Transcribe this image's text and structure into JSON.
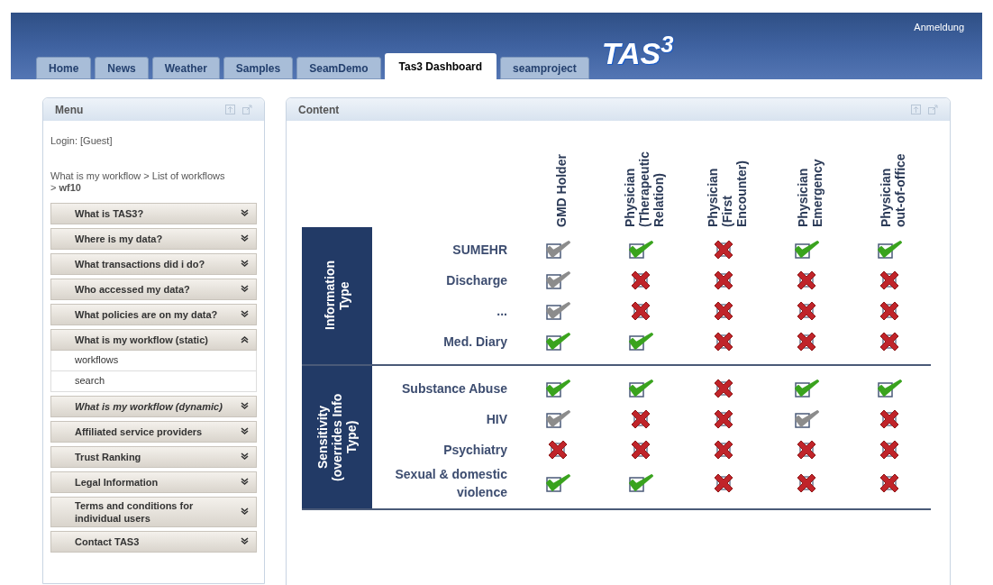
{
  "header": {
    "logo": "TAS$^{3}$",
    "login_link": "Anmeldung"
  },
  "tabs": [
    {
      "label": "Home",
      "selected": false
    },
    {
      "label": "News",
      "selected": false
    },
    {
      "label": "Weather",
      "selected": false
    },
    {
      "label": "Samples",
      "selected": false
    },
    {
      "label": "SeamDemo",
      "selected": false
    },
    {
      "label": "Tas3 Dashboard",
      "selected": true
    },
    {
      "label": "seamproject",
      "selected": false
    }
  ],
  "menu": {
    "title": "Menu",
    "login": "Login: [Guest]",
    "breadcrumb": "What is my workflow > List of workflows > **wf10**",
    "items": [
      {
        "label": "What is TAS3?",
        "expanded": false,
        "emphasized": false
      },
      {
        "label": "Where is my data?",
        "expanded": false,
        "emphasized": false
      },
      {
        "label": "What transactions did i do?",
        "expanded": false,
        "emphasized": false
      },
      {
        "label": "Who accessed my data?",
        "expanded": false,
        "emphasized": false
      },
      {
        "label": "What policies are on my data?",
        "expanded": false,
        "emphasized": false
      },
      {
        "label": "What is my workflow (static)",
        "expanded": true,
        "emphasized": false,
        "children": [
          "workflows",
          "search"
        ]
      },
      {
        "label": "What is my workflow (dynamic)",
        "expanded": false,
        "emphasized": true
      },
      {
        "label": "Affiliated service providers",
        "expanded": false,
        "emphasized": false
      },
      {
        "label": "Trust Ranking",
        "expanded": false,
        "emphasized": false
      },
      {
        "label": "Legal Information",
        "expanded": false,
        "emphasized": false
      },
      {
        "label": "Terms and conditions for individual users",
        "expanded": false,
        "emphasized": false
      },
      {
        "label": "Contact TAS3",
        "expanded": false,
        "emphasized": false
      }
    ]
  },
  "content": {
    "title": "Content",
    "columns": [
      "GMD Holder",
      "Physician (Therapeutic Relation)",
      "Physician (First Encounter)",
      "Physician Emergency",
      "Physician out-of-office"
    ],
    "groups": [
      {
        "label": "Information Type",
        "rows": [
          {
            "label": "SUMEHR",
            "cells": [
              {
                "kind": "conditional"
              },
              {
                "kind": "allow"
              },
              {
                "kind": "deny"
              },
              {
                "kind": "allow"
              },
              {
                "kind": "allow"
              }
            ]
          },
          {
            "label": "Discharge",
            "cells": [
              {
                "kind": "conditional"
              },
              {
                "kind": "deny"
              },
              {
                "kind": "deny"
              },
              {
                "kind": "deny"
              },
              {
                "kind": "deny"
              }
            ]
          },
          {
            "label": "...",
            "cells": [
              {
                "kind": "conditional"
              },
              {
                "kind": "deny"
              },
              {
                "kind": "deny"
              },
              {
                "kind": "deny"
              },
              {
                "kind": "deny"
              }
            ]
          },
          {
            "label": "Med. Diary",
            "cells": [
              {
                "kind": "allow"
              },
              {
                "kind": "allow"
              },
              {
                "kind": "deny"
              },
              {
                "kind": "deny"
              },
              {
                "kind": "deny"
              }
            ]
          }
        ]
      },
      {
        "label": "Sensitivity (overrides Info Type)",
        "rows": [
          {
            "label": "Substance Abuse",
            "cells": [
              {
                "kind": "allow"
              },
              {
                "kind": "allow"
              },
              {
                "kind": "deny"
              },
              {
                "kind": "allow"
              },
              {
                "kind": "allow"
              }
            ]
          },
          {
            "label": "HIV",
            "cells": [
              {
                "kind": "conditional"
              },
              {
                "kind": "deny"
              },
              {
                "kind": "deny"
              },
              {
                "kind": "conditional"
              },
              {
                "kind": "deny"
              }
            ]
          },
          {
            "label": "Psychiatry",
            "cells": [
              {
                "kind": "deny"
              },
              {
                "kind": "deny"
              },
              {
                "kind": "deny"
              },
              {
                "kind": "deny"
              },
              {
                "kind": "deny"
              }
            ]
          },
          {
            "label": "Sexual & domestic violence",
            "cells": [
              {
                "kind": "allow"
              },
              {
                "kind": "allow"
              },
              {
                "kind": "deny"
              },
              {
                "kind": "deny"
              },
              {
                "kind": "deny"
              }
            ]
          }
        ]
      }
    ]
  }
}
